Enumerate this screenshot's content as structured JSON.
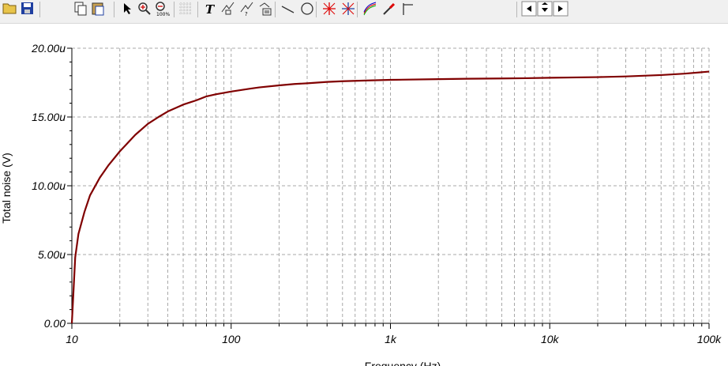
{
  "toolbar": {
    "buttons": [
      {
        "name": "open-file-button",
        "icon": "folder-open-icon"
      },
      {
        "name": "save-button",
        "icon": "floppy-disk-icon"
      },
      {
        "name": "copy-button",
        "icon": "copy-icon"
      },
      {
        "name": "paste-button",
        "icon": "paste-icon"
      },
      {
        "name": "select-pointer-button",
        "icon": "arrow-pointer-icon"
      },
      {
        "name": "zoom-in-button",
        "icon": "zoom-in-icon"
      },
      {
        "name": "zoom-100-button",
        "icon": "zoom-100-icon"
      },
      {
        "name": "grid-button",
        "icon": "grid-icon"
      },
      {
        "name": "text-tool-button",
        "icon": "text-t-icon"
      },
      {
        "name": "curve-label-button",
        "icon": "curve-label-icon"
      },
      {
        "name": "curve-label-2-button",
        "icon": "curve-label-2-icon"
      },
      {
        "name": "curve-label-3-button",
        "icon": "curve-label-3-icon"
      },
      {
        "name": "line-tool-button",
        "icon": "line-icon"
      },
      {
        "name": "circle-tool-button",
        "icon": "circle-icon"
      },
      {
        "name": "cursor-a-button",
        "icon": "cursor-a-icon"
      },
      {
        "name": "cursor-b-button",
        "icon": "cursor-b-icon"
      },
      {
        "name": "curves-button",
        "icon": "curves-icon"
      },
      {
        "name": "probe-button",
        "icon": "probe-icon"
      },
      {
        "name": "marker-button",
        "icon": "marker-icon"
      },
      {
        "name": "scroll-left-button",
        "icon": "arrow-left-icon"
      },
      {
        "name": "scroll-down-button",
        "icon": "arrow-down-icon"
      },
      {
        "name": "scroll-right-button",
        "icon": "arrow-right-icon"
      }
    ]
  },
  "colors": {
    "curve": "#800000",
    "grid": "#a8a8a8",
    "axis": "#000000",
    "toolbar_bg": "#f0f0f0"
  },
  "chart_data": {
    "type": "line",
    "xscale": "log",
    "xlabel": "Frequency (Hz)",
    "ylabel": "Total noise (V)",
    "xlim": [
      10,
      100000
    ],
    "ylim": [
      0,
      20
    ],
    "y_unit_suffix": "u",
    "x_ticks": [
      10,
      100,
      1000,
      10000,
      100000
    ],
    "x_tick_labels": [
      "10",
      "100",
      "1k",
      "10k",
      "100k"
    ],
    "y_ticks": [
      0,
      5,
      10,
      15,
      20
    ],
    "y_tick_labels": [
      "0.00",
      "5.00u",
      "10.00u",
      "15.00u",
      "20.00u"
    ],
    "grid": true,
    "series": [
      {
        "values_unit": "uV",
        "x": [
          10,
          10.5,
          11,
          12,
          13,
          15,
          17,
          20,
          25,
          30,
          35,
          40,
          50,
          60,
          70,
          80,
          100,
          130,
          150,
          200,
          250,
          300,
          400,
          500,
          700,
          1000,
          2000,
          3000,
          5000,
          7000,
          10000,
          20000,
          30000,
          50000,
          70000,
          100000
        ],
        "y": [
          0.0,
          4.8,
          6.5,
          8.1,
          9.3,
          10.6,
          11.5,
          12.5,
          13.7,
          14.5,
          15.0,
          15.4,
          15.9,
          16.2,
          16.5,
          16.65,
          16.85,
          17.05,
          17.15,
          17.3,
          17.4,
          17.45,
          17.55,
          17.6,
          17.65,
          17.7,
          17.75,
          17.78,
          17.8,
          17.82,
          17.85,
          17.9,
          17.95,
          18.05,
          18.15,
          18.3
        ]
      }
    ]
  }
}
